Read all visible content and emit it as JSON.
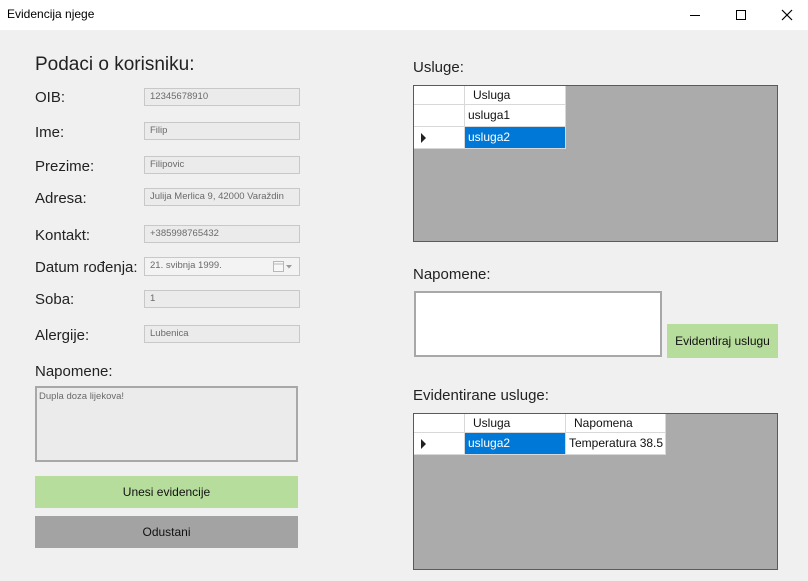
{
  "window": {
    "title": "Evidencija njege"
  },
  "colors": {
    "accent_green": "#b6dd9c",
    "selection_blue": "#0078d7",
    "grid_background": "#ababab",
    "cancel_gray": "#a3a3a3"
  },
  "korisnik": {
    "heading": "Podaci o korisniku:",
    "oib_label": "OIB:",
    "oib_value": "12345678910",
    "ime_label": "Ime:",
    "ime_value": "Filip",
    "prezime_label": "Prezime:",
    "prezime_value": "Filipovic",
    "adresa_label": "Adresa:",
    "adresa_value": "Julija Merlica 9, 42000 Varaždin",
    "kontakt_label": "Kontakt:",
    "kontakt_value": "+385998765432",
    "datum_label": "Datum rođenja:",
    "datum_value": "21.  svibnja  1999.",
    "soba_label": "Soba:",
    "soba_value": "1",
    "alergije_label": "Alergije:",
    "alergije_value": "Lubenica",
    "napomene_label": "Napomene:",
    "napomene_value": "Dupla doza lijekova!"
  },
  "buttons": {
    "unesi": "Unesi evidencije",
    "odustani": "Odustani",
    "evidentiraj": "Evidentiraj uslugu"
  },
  "usluge": {
    "label": "Usluge:",
    "columns": [
      "Usluga"
    ],
    "rows": [
      {
        "usluga": "usluga1"
      },
      {
        "usluga": "usluga2"
      }
    ],
    "selected_row": 1
  },
  "napomene_usluga": {
    "label": "Napomene:",
    "value": ""
  },
  "evidentirane": {
    "label": "Evidentirane usluge:",
    "columns": [
      "Usluga",
      "Napomena"
    ],
    "rows": [
      {
        "usluga": "usluga2",
        "napomena": "Temperatura 38.5"
      }
    ]
  }
}
